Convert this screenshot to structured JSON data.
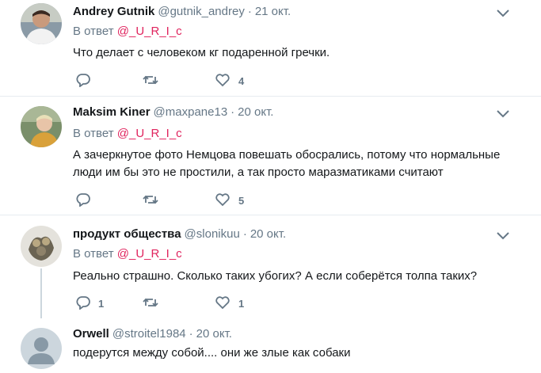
{
  "tweets": [
    {
      "name": "Andrey Gutnik",
      "handle": "@gutnik_andrey",
      "dot": "·",
      "time": "21 окт.",
      "reply_prefix": "В ответ",
      "reply_to": "@_U_R_I_c",
      "text": "Что делает с человеком кг подаренной гречки.",
      "replies": "",
      "retweets": "",
      "likes": "4"
    },
    {
      "name": "Maksim Kiner",
      "handle": "@maxpane13",
      "dot": "·",
      "time": "20 окт.",
      "reply_prefix": "В ответ",
      "reply_to": "@_U_R_I_c",
      "text": "А зачеркнутое фото Немцова повешать обосрались, потому что нормальные люди им бы это не простили, а так просто маразматиками считают",
      "replies": "",
      "retweets": "",
      "likes": "5"
    },
    {
      "name": "продукт общества",
      "handle": "@slonikuu",
      "dot": "·",
      "time": "20 окт.",
      "reply_prefix": "В ответ",
      "reply_to": "@_U_R_I_c",
      "text": "Реально страшно. Сколько таких убогих? А если соберётся толпа таких?",
      "replies": "1",
      "retweets": "",
      "likes": "1"
    },
    {
      "name": "Orwell",
      "handle": "@stroitel1984",
      "dot": "·",
      "time": "20 окт.",
      "text": "подерутся между собой.... они же злые как собаки"
    }
  ],
  "icons": {
    "reply": "reply-icon",
    "retweet": "retweet-icon",
    "like": "heart-icon",
    "more": "chevron-down-icon"
  },
  "colors": {
    "mention": "#e0245e",
    "secondary": "#657786",
    "separator": "#e6ecf0",
    "thread_line": "#ccd6dd"
  }
}
